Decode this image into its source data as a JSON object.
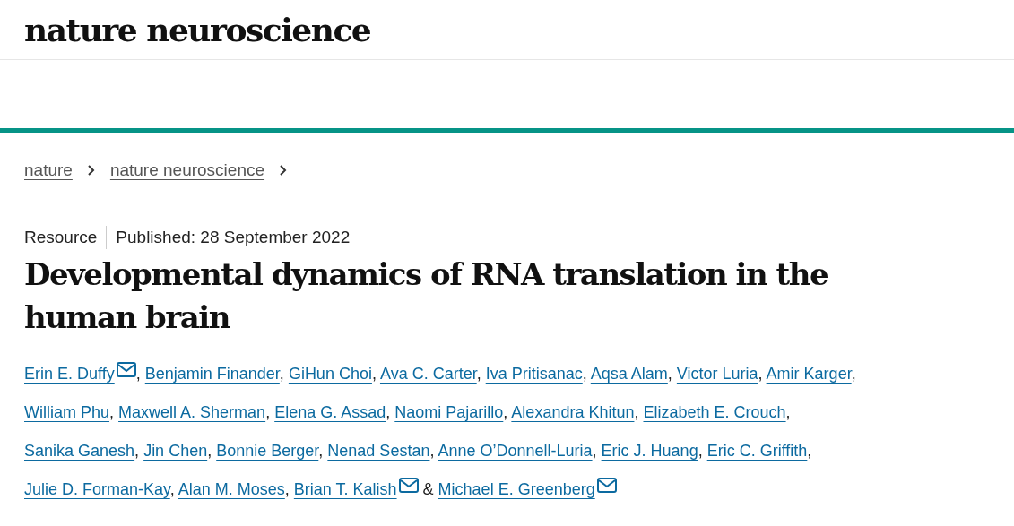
{
  "site": {
    "logo": "nature neuroscience"
  },
  "breadcrumbs": [
    {
      "label": "nature"
    },
    {
      "label": "nature neuroscience"
    }
  ],
  "article": {
    "type": "Resource",
    "published": "Published: 28 September 2022",
    "title": "Developmental dynamics of RNA translation in the human brain",
    "authors": [
      {
        "name": "Erin E. Duffy",
        "email": true,
        "sep": ","
      },
      {
        "name": "Benjamin Finander",
        "email": false,
        "sep": ","
      },
      {
        "name": "GiHun Choi",
        "email": false,
        "sep": ","
      },
      {
        "name": "Ava C. Carter",
        "email": false,
        "sep": ","
      },
      {
        "name": "Iva Pritisanac",
        "email": false,
        "sep": ","
      },
      {
        "name": "Aqsa Alam",
        "email": false,
        "sep": ","
      },
      {
        "name": "Victor Luria",
        "email": false,
        "sep": ","
      },
      {
        "name": "Amir Karger",
        "email": false,
        "sep": ","
      },
      {
        "name": "William Phu",
        "email": false,
        "sep": ","
      },
      {
        "name": "Maxwell A. Sherman",
        "email": false,
        "sep": ","
      },
      {
        "name": "Elena G. Assad",
        "email": false,
        "sep": ","
      },
      {
        "name": "Naomi Pajarillo",
        "email": false,
        "sep": ","
      },
      {
        "name": "Alexandra Khitun",
        "email": false,
        "sep": ","
      },
      {
        "name": "Elizabeth E. Crouch",
        "email": false,
        "sep": ","
      },
      {
        "name": "Sanika Ganesh",
        "email": false,
        "sep": ","
      },
      {
        "name": "Jin Chen",
        "email": false,
        "sep": ","
      },
      {
        "name": "Bonnie Berger",
        "email": false,
        "sep": ","
      },
      {
        "name": "Nenad Sestan",
        "email": false,
        "sep": ","
      },
      {
        "name": "Anne O’Donnell-Luria",
        "email": false,
        "sep": ","
      },
      {
        "name": "Eric J. Huang",
        "email": false,
        "sep": ","
      },
      {
        "name": "Eric C. Griffith",
        "email": false,
        "sep": ","
      },
      {
        "name": "Julie D. Forman-Kay",
        "email": false,
        "sep": ","
      },
      {
        "name": "Alan M. Moses",
        "email": false,
        "sep": ","
      },
      {
        "name": "Brian T. Kalish",
        "email": true,
        "sep": "&"
      },
      {
        "name": "Michael E. Greenberg",
        "email": true
      }
    ]
  }
}
